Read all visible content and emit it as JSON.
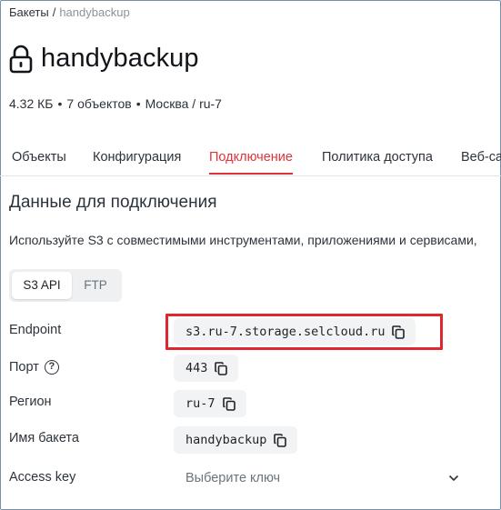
{
  "breadcrumb": {
    "root": "Бакеты",
    "separator": "/",
    "current": "handybackup"
  },
  "bucket": {
    "name": "handybackup",
    "lock_icon": "lock-icon"
  },
  "meta": {
    "size": "4.32 КБ",
    "objects": "7 объектов",
    "location": "Москва / ru-7",
    "dot": "•"
  },
  "tabs": [
    {
      "label": "Объекты"
    },
    {
      "label": "Конфигурация"
    },
    {
      "label": "Подключение"
    },
    {
      "label": "Политика доступа"
    },
    {
      "label": "Веб-са"
    }
  ],
  "connection": {
    "title": "Данные для подключения",
    "hint": "Используйте S3 с совместимыми инструментами, приложениями и сервисами,",
    "protocols": {
      "s3": "S3 API",
      "ftp": "FTP",
      "selected": "S3 API"
    }
  },
  "fields": {
    "endpoint": {
      "label": "Endpoint",
      "value": "s3.ru-7.storage.selcloud.ru"
    },
    "port": {
      "label": "Порт",
      "help": "?",
      "value": "443"
    },
    "region": {
      "label": "Регион",
      "value": "ru-7"
    },
    "bucket_name": {
      "label": "Имя бакета",
      "value": "handybackup"
    },
    "access_key": {
      "label": "Access key",
      "placeholder": "Выберите ключ"
    }
  },
  "colors": {
    "accent": "#e0343a",
    "highlight": "#e0262f",
    "chip_bg": "#f1f3f5"
  }
}
